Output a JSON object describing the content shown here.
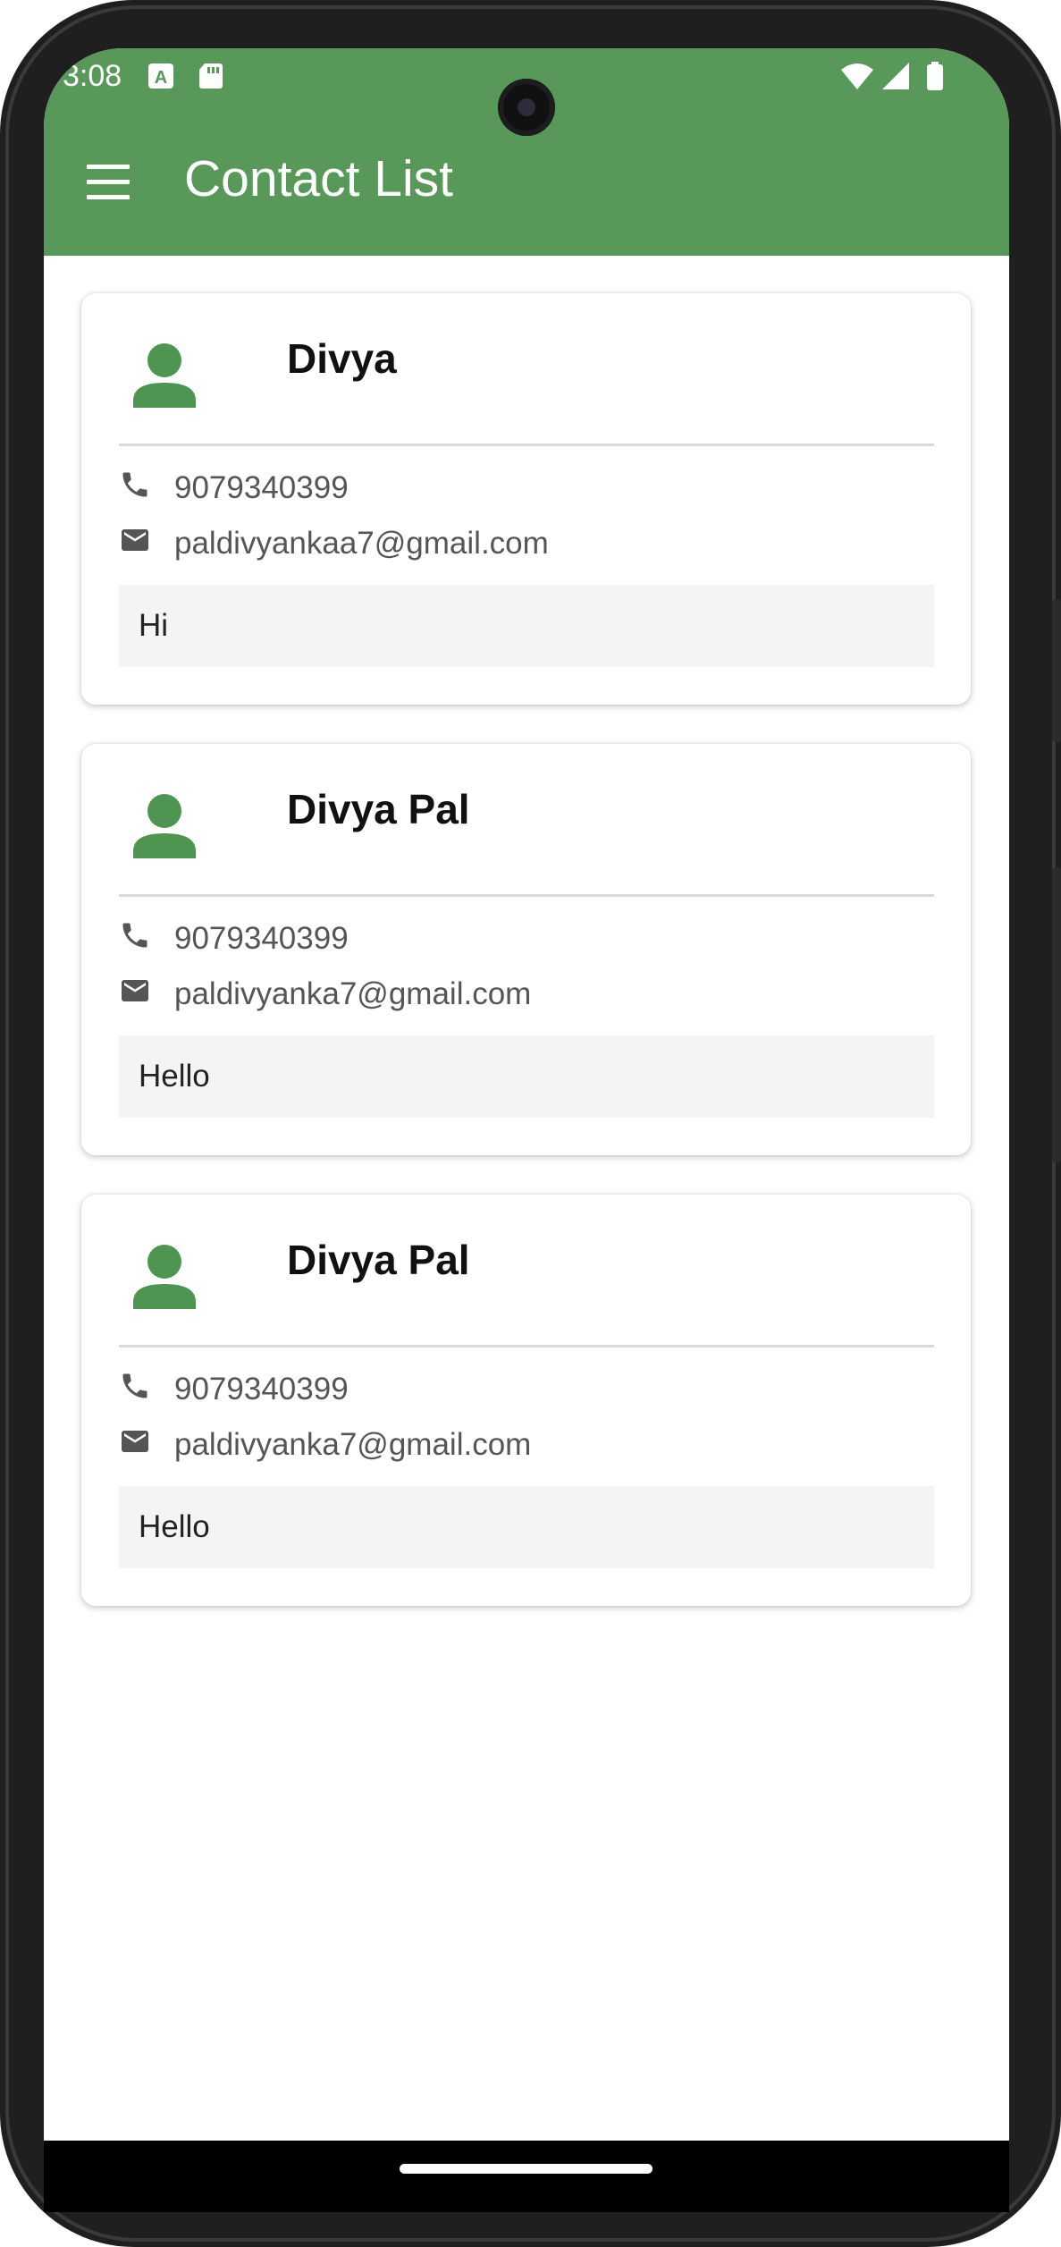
{
  "status_bar": {
    "time": "3:08",
    "icons": [
      "keyboard-a-icon",
      "sd-card-icon",
      "wifi-icon",
      "signal-icon",
      "battery-icon"
    ]
  },
  "app_bar": {
    "title": "Contact List",
    "menu_icon": "hamburger-menu-icon",
    "background_color": "#58995a"
  },
  "contacts": [
    {
      "name": "Divya",
      "phone": "9079340399",
      "email": "paldivyankaa7@gmail.com",
      "message": "Hi"
    },
    {
      "name": "Divya Pal",
      "phone": "9079340399",
      "email": "paldivyanka7@gmail.com",
      "message": "Hello"
    },
    {
      "name": "Divya Pal",
      "phone": "9079340399",
      "email": "paldivyanka7@gmail.com",
      "message": "Hello"
    }
  ],
  "colors": {
    "accent": "#58995a",
    "avatar": "#4d9550",
    "row_icon": "#555555"
  }
}
